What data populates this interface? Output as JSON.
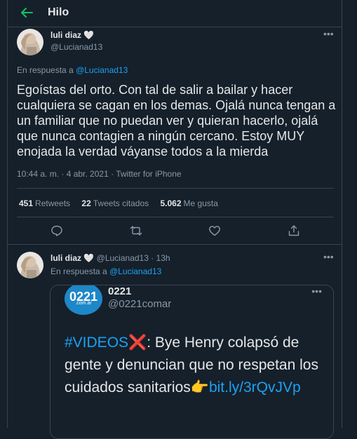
{
  "header": {
    "title": "Hilo"
  },
  "tweet": {
    "author_name": "luli diaz",
    "author_emoji": "🤍",
    "author_handle": "@Lucianad13",
    "reply_prefix": "En respuesta a ",
    "reply_to": "@Lucianad13",
    "text": "Egoístas del orto. Con tal de salir a bailar y hacer cualquiera se cagan en los demas. Ojalá nunca tengan a un familiar que no puedan ver y quieran hacerlo, ojalá que nunca contagien a ningún cercano. Estoy MUY enojada la verdad váyanse todos a la mierda",
    "meta": "10:44 a. m. · 4 abr. 2021 · Twitter for iPhone",
    "stats": [
      {
        "count": "451",
        "label": "Retweets"
      },
      {
        "count": "22",
        "label": "Tweets citados"
      },
      {
        "count": "5.062",
        "label": "Me gusta"
      }
    ]
  },
  "reply_tweet": {
    "author_name": "luli diaz",
    "author_emoji": "🤍",
    "handle_time": "@Lucianad13 · 13h",
    "reply_prefix": "En respuesta a ",
    "reply_to": "@Lucianad13",
    "quote": {
      "logo_text": "0221",
      "logo_sub": ".com.ar",
      "name": "0221",
      "handle": "@0221comar",
      "hashtag": "#VIDEOS",
      "cross": "❌",
      "text": ": Bye Henry colapsó de gente y denuncian que no respetan los cuidados sanitarios",
      "emoji": "👉",
      "link": "bit.ly/3rQvJVp"
    }
  },
  "icons": [
    "back-arrow-icon",
    "more-icon",
    "reply-icon",
    "retweet-icon",
    "like-icon",
    "share-icon"
  ],
  "colors": {
    "background": "#15202b",
    "accent_green": "#17bf63",
    "link": "#1da1f2",
    "muted": "#8899a6"
  }
}
